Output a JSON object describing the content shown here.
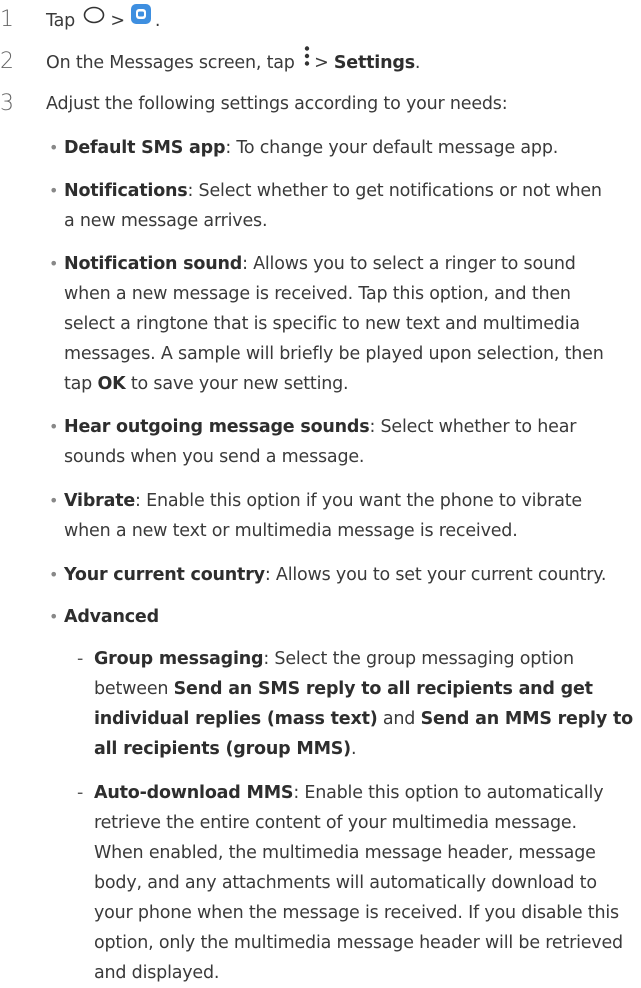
{
  "steps": [
    {
      "num": "1",
      "text": "Tap",
      "period": "."
    },
    {
      "num": "2",
      "pre": "On the Messages screen, tap",
      "arrow": ">",
      "bold": "Settings",
      "period": "."
    },
    {
      "num": "3",
      "text": "Adjust the following settings according to your needs:"
    }
  ],
  "step1_arrow": ">",
  "icons": {
    "home": "home-circle-icon",
    "messages": "messages-app-icon",
    "more": "more-vertical-icon"
  },
  "settings": [
    {
      "term": "Default SMS app",
      "desc": ": To change your default message app."
    },
    {
      "term": "Notifications",
      "desc1": ": Select whether to get notifications or not when",
      "desc2": "a new message arrives."
    },
    {
      "term": "Notification sound",
      "desc1": ": Allows you to select a ringer to sound",
      "desc2": "when a new message is received. Tap this option, and then",
      "desc3": "select a ringtone that is specific to new text and multimedia",
      "desc4": "messages. A sample will briefly be played upon selection, then",
      "desc5a": "tap ",
      "desc5b": "OK",
      "desc5c": " to save your new setting."
    },
    {
      "term": "Hear outgoing message sounds",
      "desc1": ": Select whether to hear",
      "desc2": "sounds when you send a message."
    },
    {
      "term": "Vibrate",
      "desc1": ": Enable this option if you want the phone to vibrate",
      "desc2": "when a new text or multimedia message is received."
    },
    {
      "term": "Your current country",
      "desc": ": Allows you to set your current country."
    },
    {
      "term": "Advanced"
    }
  ],
  "advanced": [
    {
      "term": "Group messaging",
      "desc1": ": Select the group messaging option",
      "desc2": "between ",
      "opt1a": "Send an SMS reply to all recipients and get",
      "opt1b": "individual replies (mass text)",
      "and": " and ",
      "opt2a": "Send an MMS reply to",
      "opt2b": "all recipients (group MMS)",
      "end": "."
    },
    {
      "term": "Auto-download MMS",
      "desc1": ": Enable this option to automatically",
      "desc2": "retrieve the entire content of your multimedia message.",
      "desc3": "When enabled, the multimedia message header, message",
      "desc4": "body, and any attachments will automatically download to",
      "desc5": "your phone when the message is received. If you disable this",
      "desc6": "option, only the multimedia message header will be retrieved",
      "desc7": "and displayed."
    }
  ],
  "bullet_char": "•",
  "dash_char": "-"
}
